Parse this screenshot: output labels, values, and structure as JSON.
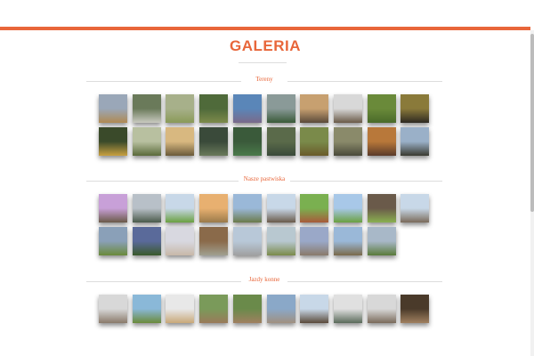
{
  "page": {
    "title": "GALERIA"
  },
  "sections": [
    {
      "label": "Tereny",
      "rows": [
        [
          {
            "sky": "#9aa7b8",
            "ground": "#b08a52"
          },
          {
            "sky": "#6a7a5a",
            "ground": "#c9c9c0"
          },
          {
            "sky": "#a7b08a",
            "ground": "#8a9a58"
          },
          {
            "sky": "#4f6a3a",
            "ground": "#7d8a4a"
          },
          {
            "sky": "#5a86b8",
            "ground": "#7a6a8a"
          },
          {
            "sky": "#8a9a98",
            "ground": "#3a5a38"
          },
          {
            "sky": "#c7a070",
            "ground": "#5a4a3a"
          },
          {
            "sky": "#d8d8d8",
            "ground": "#6a5a48"
          },
          {
            "sky": "#6a8a3a",
            "ground": "#4a6a2a"
          },
          {
            "sky": "#8a7a3a",
            "ground": "#2e2a22"
          }
        ],
        [
          {
            "sky": "#3a4a2a",
            "ground": "#c8a040"
          },
          {
            "sky": "#b8c0a0",
            "ground": "#5a6a3a"
          },
          {
            "sky": "#d8b880",
            "ground": "#6a5a3a"
          },
          {
            "sky": "#3a4a3a",
            "ground": "#6a7a5a"
          },
          {
            "sky": "#3a5a3a",
            "ground": "#4a7a4a"
          },
          {
            "sky": "#5a6a4a",
            "ground": "#3a4a3a"
          },
          {
            "sky": "#7a8a4a",
            "ground": "#6a5a2a"
          },
          {
            "sky": "#8a8a6a",
            "ground": "#4a4a3a"
          },
          {
            "sky": "#b8783a",
            "ground": "#5a3a2a"
          },
          {
            "sky": "#9ab0c8",
            "ground": "#3a3a30"
          }
        ]
      ]
    },
    {
      "label": "Nasze pastwiska",
      "rows": [
        [
          {
            "sky": "#c8a0d8",
            "ground": "#6a5a48"
          },
          {
            "sky": "#b8c0c8",
            "ground": "#4a5a4a"
          },
          {
            "sky": "#c8d8e8",
            "ground": "#6aa040"
          },
          {
            "sky": "#e8b070",
            "ground": "#9a7a4a"
          },
          {
            "sky": "#9ab8d8",
            "ground": "#6a7a4a"
          },
          {
            "sky": "#c8d8e8",
            "ground": "#6a5a4a"
          },
          {
            "sky": "#7ab050",
            "ground": "#a85a3a"
          },
          {
            "sky": "#a8c8e8",
            "ground": "#6aa040"
          },
          {
            "sky": "#6a5a4a",
            "ground": "#8ab050"
          },
          {
            "sky": "#c8d8e8",
            "ground": "#7a6a5a"
          }
        ],
        [
          {
            "sky": "#8aa0b8",
            "ground": "#6a8a3a"
          },
          {
            "sky": "#5a6a9a",
            "ground": "#3a5a2a"
          },
          {
            "sky": "#d8d8e0",
            "ground": "#c8b8a8"
          },
          {
            "sky": "#8a6a4a",
            "ground": "#a0a090"
          },
          {
            "sky": "#b8c8d8",
            "ground": "#a0a0a0"
          },
          {
            "sky": "#b8c8d0",
            "ground": "#7a8a4a"
          },
          {
            "sky": "#9aa8c8",
            "ground": "#8a7a6a"
          },
          {
            "sky": "#9ab8d8",
            "ground": "#7a6a4a"
          },
          {
            "sky": "#a8b8c8",
            "ground": "#5a7a3a"
          }
        ]
      ]
    },
    {
      "label": "Jazdy konne",
      "rows": [
        [
          {
            "sky": "#d8d8d8",
            "ground": "#8a7a6a"
          },
          {
            "sky": "#8ab8d8",
            "ground": "#6a8a3a"
          },
          {
            "sky": "#e8e8e8",
            "ground": "#c8a878"
          },
          {
            "sky": "#7a9a5a",
            "ground": "#9a7a5a"
          },
          {
            "sky": "#6a8a4a",
            "ground": "#a08060"
          },
          {
            "sky": "#8aa8c8",
            "ground": "#a09080"
          },
          {
            "sky": "#c8d8e8",
            "ground": "#5a4a3a"
          },
          {
            "sky": "#e0e0e0",
            "ground": "#5a6a5a"
          },
          {
            "sky": "#d8d8d8",
            "ground": "#7a6a5a"
          },
          {
            "sky": "#4a3a2a",
            "ground": "#a08060"
          }
        ]
      ]
    }
  ]
}
